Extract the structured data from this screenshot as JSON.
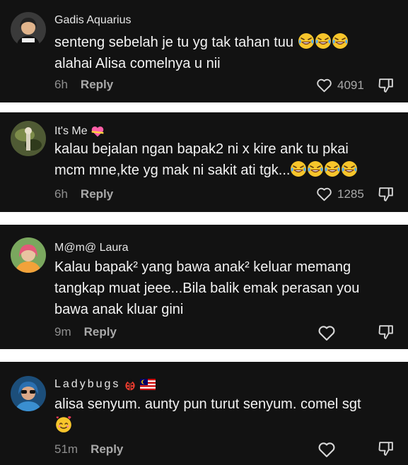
{
  "comments": [
    {
      "author": "Gadis Aquarius",
      "lines": [
        "senteng sebelah je tu yg tak tahan tuu",
        "alahai Alisa comelnya u nii"
      ],
      "time": "6h",
      "reply": "Reply",
      "likes": "4091"
    },
    {
      "author": "It's Me",
      "lines": [
        "kalau bejalan ngan bapak2 ni x kire ank tu pkai",
        "mcm mne,kte yg mak ni sakit ati tgk..."
      ],
      "time": "6h",
      "reply": "Reply",
      "likes": "1285"
    },
    {
      "author": "M@m@ Laura",
      "lines": [
        "Kalau bapak² yang bawa anak² keluar memang",
        "tangkap muat jeee...Bila balik emak perasan you",
        "bawa anak kluar gini"
      ],
      "time": "9m",
      "reply": "Reply",
      "likes": ""
    },
    {
      "author": "Ladybugs",
      "lines": [
        "alisa senyum. aunty pun turut senyum. comel sgt"
      ],
      "time": "51m",
      "reply": "Reply",
      "likes": ""
    }
  ],
  "icons": {
    "like": "heart-outline-icon",
    "dislike": "thumbs-down-icon",
    "laugh_emoji": "face-with-tears-of-joy",
    "heart_emoji": "heart-with-ribbon",
    "love_emoji": "smiling-face-with-hearts",
    "flag": "malaysia-flag",
    "bug": "ladybug"
  },
  "colors": {
    "card_bg": "#121212",
    "separator": "#ffffff",
    "text": "#f3f3f3",
    "meta": "#8f8f8f"
  }
}
